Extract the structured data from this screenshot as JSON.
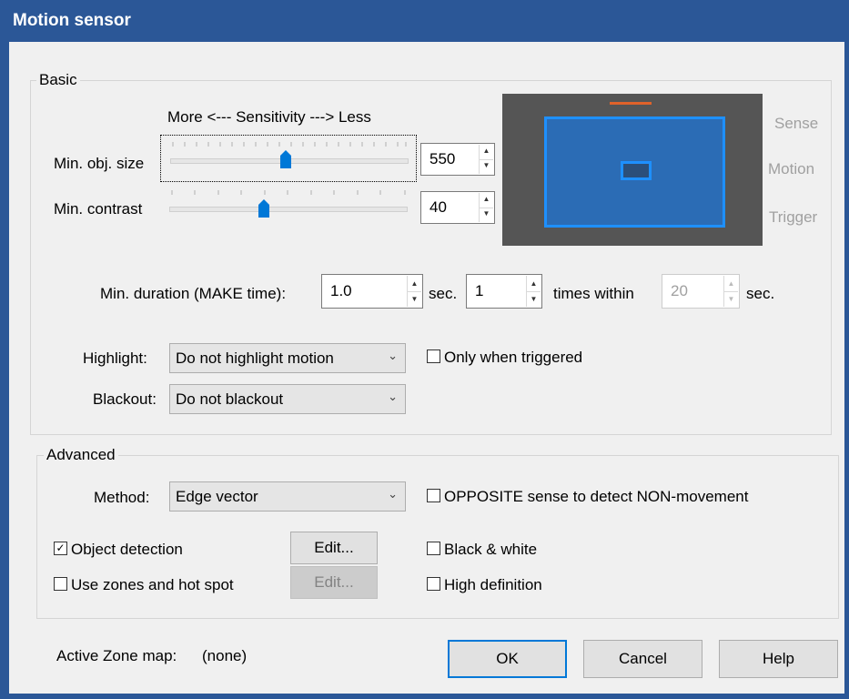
{
  "window": {
    "title": "Motion sensor"
  },
  "basic": {
    "legend": "Basic",
    "sensitivity_label": "More <--- Sensitivity ---> Less",
    "min_obj_size": {
      "label": "Min. obj. size",
      "value": "550",
      "level": 0.49
    },
    "min_contrast": {
      "label": "Min. contrast",
      "value": "40",
      "level": 0.4
    },
    "min_duration": {
      "label": "Min. duration (MAKE time):",
      "value": "1.0",
      "unit": "sec."
    },
    "times": {
      "value": "1",
      "label": "times within"
    },
    "within": {
      "value": "20",
      "unit": "sec."
    },
    "highlight": {
      "label": "Highlight:",
      "value": "Do not highlight motion"
    },
    "blackout": {
      "label": "Blackout:",
      "value": "Do not blackout"
    },
    "only_when_triggered": {
      "label": "Only when triggered",
      "checked": false
    },
    "preview": {
      "labels": [
        "Sense",
        "Motion",
        "Trigger"
      ],
      "colors": {
        "background": "#555555",
        "zone": "#2b6cb5",
        "border": "#1e90ff",
        "marker": "#e0622a"
      }
    }
  },
  "advanced": {
    "legend": "Advanced",
    "method": {
      "label": "Method:",
      "value": "Edge vector"
    },
    "opposite_sense": {
      "label": "OPPOSITE sense to detect NON-movement",
      "checked": false
    },
    "object_detection": {
      "label": "Object detection",
      "checked": true,
      "edit_label": "Edit..."
    },
    "use_zones": {
      "label": "Use zones and hot spot",
      "checked": false,
      "edit_label": "Edit..."
    },
    "black_white": {
      "label": "Black & white",
      "checked": false
    },
    "high_definition": {
      "label": "High definition",
      "checked": false
    }
  },
  "footer": {
    "active_zone_label": "Active Zone map:",
    "active_zone_value": "(none)",
    "ok_label": "OK",
    "cancel_label": "Cancel",
    "help_label": "Help"
  },
  "icons": {
    "checkmark": "☑",
    "unchecked": "☐",
    "spin_up": "▲",
    "spin_down": "▼",
    "dropdown": "⌄"
  }
}
